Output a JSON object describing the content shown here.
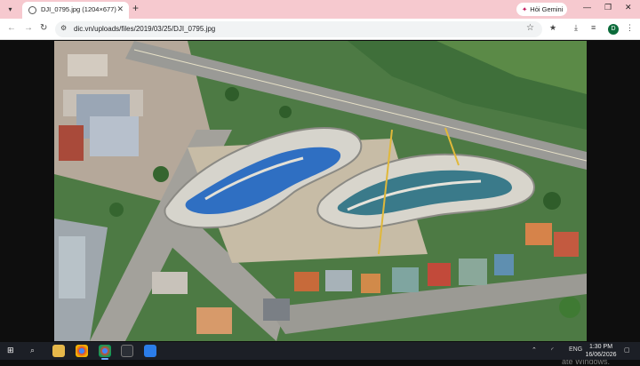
{
  "browser": {
    "tab_title": "DJI_0795.jpg (1204×677)",
    "gemini_label": "Hỏi Gemini",
    "url": "dic.vn/uploads/files/2019/03/25/DJI_0795.jpg",
    "profile_initial": "D"
  },
  "photo": {
    "alt": "Aerial view of a curved building complex under construction beside roads and greenery"
  },
  "overlay": {
    "watermark": "ate Windows."
  },
  "taskbar": {
    "language": "ENG",
    "time": "1:30 PM",
    "date": "16/06/2026"
  },
  "colors": {
    "tabstrip": "#f6c9cf",
    "taskbar": "#1c1f26"
  }
}
